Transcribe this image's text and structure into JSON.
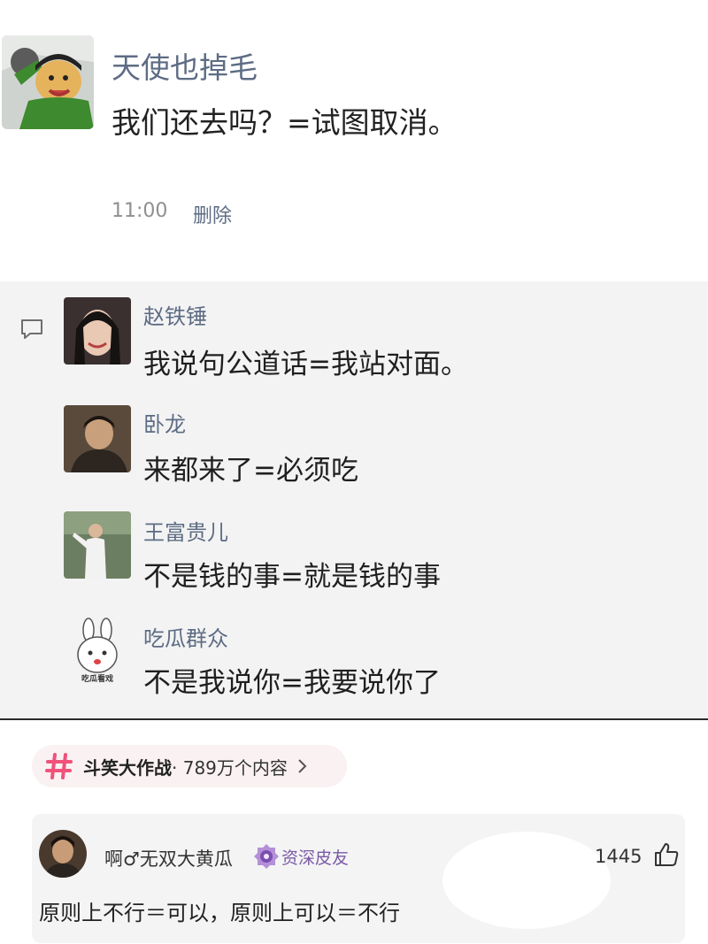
{
  "post": {
    "author": "天使也掉毛",
    "text": "我们还去吗？=试图取消。",
    "time": "11:00",
    "delete_label": "删除"
  },
  "comments": [
    {
      "name": "赵铁锤",
      "text": "我说句公道话=我站对面。"
    },
    {
      "name": "卧龙",
      "text": "来都来了=必须吃"
    },
    {
      "name": "王富贵儿",
      "text": "不是钱的事=就是钱的事"
    },
    {
      "name": "吃瓜群众",
      "text": "不是我说你=我要说你了"
    }
  ],
  "avatar_caption": "吃瓜看戏",
  "topic": {
    "name": "斗笑大作战",
    "count": "· 789万个内容",
    "accent": "#f0527a"
  },
  "reply": {
    "username": "啊♂无双大黄瓜",
    "badge": "资深皮友",
    "likes": "1445",
    "text": "原则上不行＝可以，原则上可以＝不行"
  },
  "colors": {
    "name_blue": "#5d6c84",
    "panel_gray": "#f3f3f3"
  }
}
